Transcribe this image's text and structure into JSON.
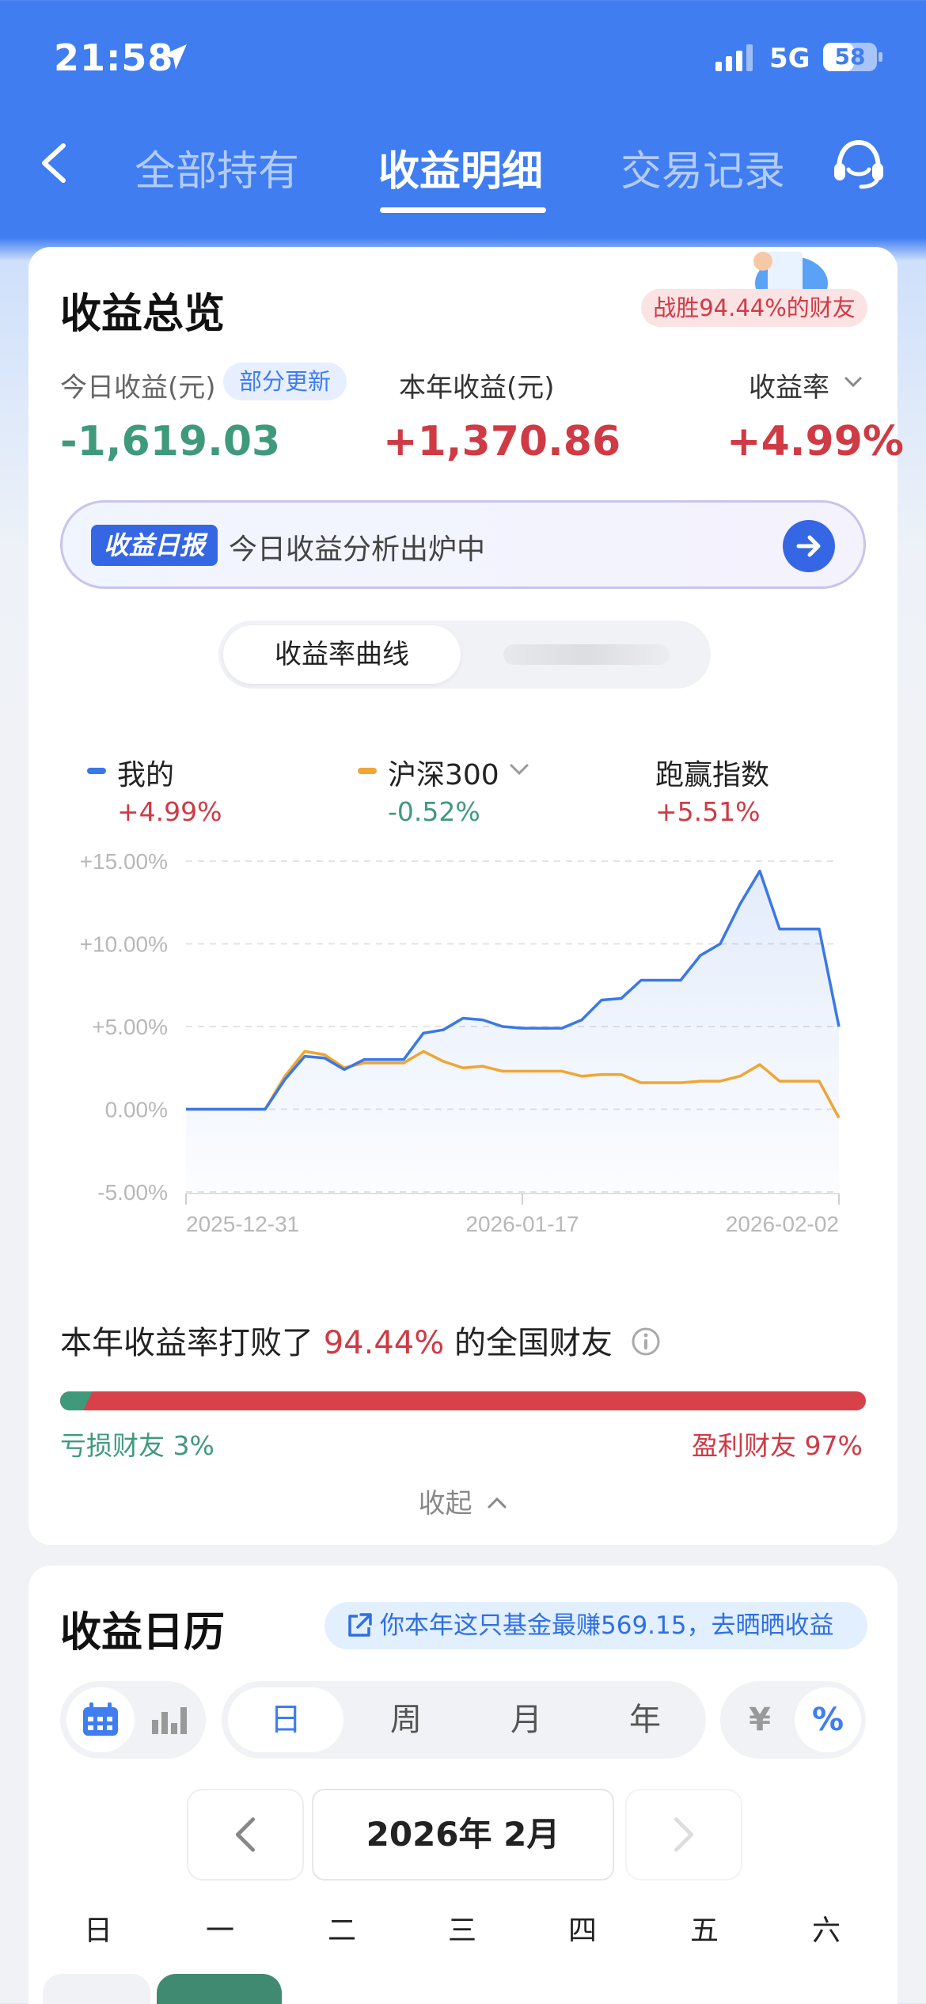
{
  "status_bar": {
    "time": "21:58",
    "network": "5G",
    "battery": "58",
    "battery_level": 0.58
  },
  "nav": {
    "tabs": [
      {
        "label": "全部持有"
      },
      {
        "label": "收益明细"
      },
      {
        "label": "交易记录"
      }
    ],
    "active_tab": "收益明细"
  },
  "overview": {
    "title": "收益总览",
    "beat_badge": "战胜94.44%的财友",
    "today_label": "今日收益(元)",
    "partial_update": "部分更新",
    "today_value": "-1,619.03",
    "year_label": "本年收益(元)",
    "year_value": "+1,370.86",
    "rate_label": "收益率",
    "rate_value": "+4.99%",
    "report_tag": "收益日报",
    "report_text": "今日收益分析出炉中",
    "toggle_active": "收益率曲线"
  },
  "legend": [
    {
      "name": "我的",
      "value": "+4.99%",
      "color": "#3a78e6"
    },
    {
      "name": "沪深300",
      "value": "-0.52%",
      "color": "#f0a534"
    },
    {
      "name": "跑赢指数",
      "value": "+5.51%"
    }
  ],
  "chart_data": {
    "type": "line",
    "ylim": [
      -5,
      15
    ],
    "yticks": [
      "+15.00%",
      "+10.00%",
      "+5.00%",
      "0.00%",
      "-5.00%"
    ],
    "xticks": [
      "2025-12-31",
      "2026-01-17",
      "2026-02-02"
    ],
    "series": [
      {
        "name": "我的",
        "color": "#3a78e6",
        "values": [
          0,
          0,
          0,
          0,
          0,
          1.8,
          3.2,
          3.1,
          2.4,
          3.0,
          3.0,
          3.0,
          4.6,
          4.8,
          5.5,
          5.4,
          5.0,
          4.9,
          4.9,
          4.9,
          5.4,
          6.6,
          6.7,
          7.8,
          7.8,
          7.8,
          9.3,
          10.0,
          12.4,
          14.4,
          10.9,
          10.9,
          10.9,
          4.99
        ]
      },
      {
        "name": "沪深300",
        "color": "#f0a534",
        "values": [
          0,
          0,
          0,
          0,
          0,
          2.0,
          3.5,
          3.3,
          2.5,
          2.8,
          2.8,
          2.8,
          3.5,
          2.9,
          2.5,
          2.6,
          2.3,
          2.3,
          2.3,
          2.3,
          2.0,
          2.1,
          2.1,
          1.6,
          1.6,
          1.6,
          1.7,
          1.7,
          2.0,
          2.7,
          1.7,
          1.7,
          1.7,
          -0.52
        ]
      }
    ]
  },
  "beat": {
    "prefix": "本年收益率打败了",
    "percent": "94.44%",
    "suffix": "的全国财友",
    "loss_label": "亏损财友 3%",
    "gain_label": "盈利财友 97%",
    "loss_fraction": 0.03,
    "collapse": "收起"
  },
  "calendar": {
    "title": "收益日历",
    "share_text": "你本年这只基金最赚569.15，去晒晒收益",
    "periods": [
      "日",
      "周",
      "月",
      "年"
    ],
    "active_period": "日",
    "units": [
      "¥",
      "%"
    ],
    "active_unit": "%",
    "month": "2026年 2月",
    "weekdays": [
      "日",
      "一",
      "二",
      "三",
      "四",
      "五",
      "六"
    ]
  }
}
